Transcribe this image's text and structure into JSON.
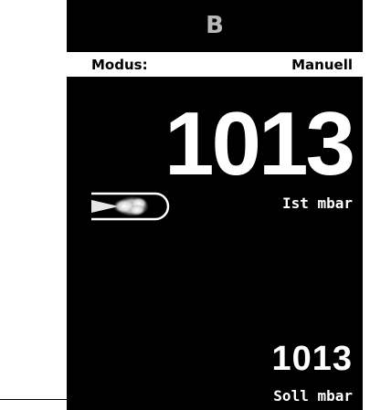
{
  "header": {
    "title": "B"
  },
  "mode": {
    "label": "Modus:",
    "value": "Manuell"
  },
  "pressure": {
    "actual_value": "1013",
    "actual_label": "Ist mbar",
    "target_value": "1013",
    "target_label": "Soll mbar"
  },
  "icons": {
    "valve": "gas-flow-valve-icon"
  },
  "colors": {
    "panel_background": "#000000",
    "text": "#ffffff",
    "title_text": "#b8b8b8",
    "mode_row_background": "#ffffff"
  }
}
